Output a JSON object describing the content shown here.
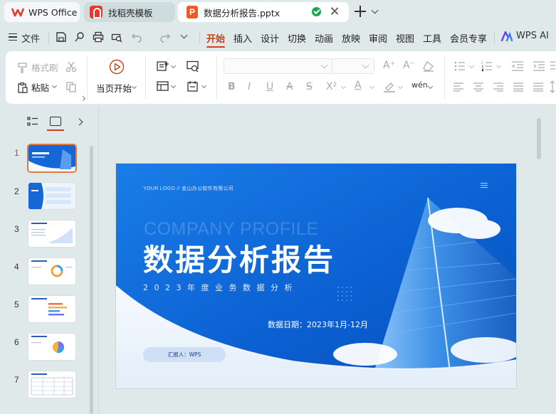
{
  "tabs": {
    "home": "WPS Office",
    "templates": "找稻壳模板",
    "document": "数据分析报告.pptx"
  },
  "menu": {
    "file": "文件",
    "items": [
      "开始",
      "插入",
      "设计",
      "切换",
      "动画",
      "放映",
      "审阅",
      "视图",
      "工具",
      "会员专享"
    ],
    "ai": "WPS AI"
  },
  "ribbon": {
    "format_painter": "格式刷",
    "paste": "粘贴",
    "play_from_current": "当页开始",
    "phonetic": "wén"
  },
  "slides_panel": {
    "numbers": [
      "1",
      "2",
      "3",
      "4",
      "5",
      "6",
      "7"
    ],
    "active": 1
  },
  "slide": {
    "logo": "YOUR LOGO // 金山办公软件有限公司",
    "watermark": "COMPANY PROFILE",
    "title": "数据分析报告",
    "subtitle": "2023年度业务数据分析",
    "date": "数据日期：2023年1月-12月",
    "reporter": "汇报人：WPS"
  },
  "colors": {
    "accent": "#c8421c",
    "slide_blue": "#0b63d6",
    "active_thumb_border": "#e07b3f"
  }
}
